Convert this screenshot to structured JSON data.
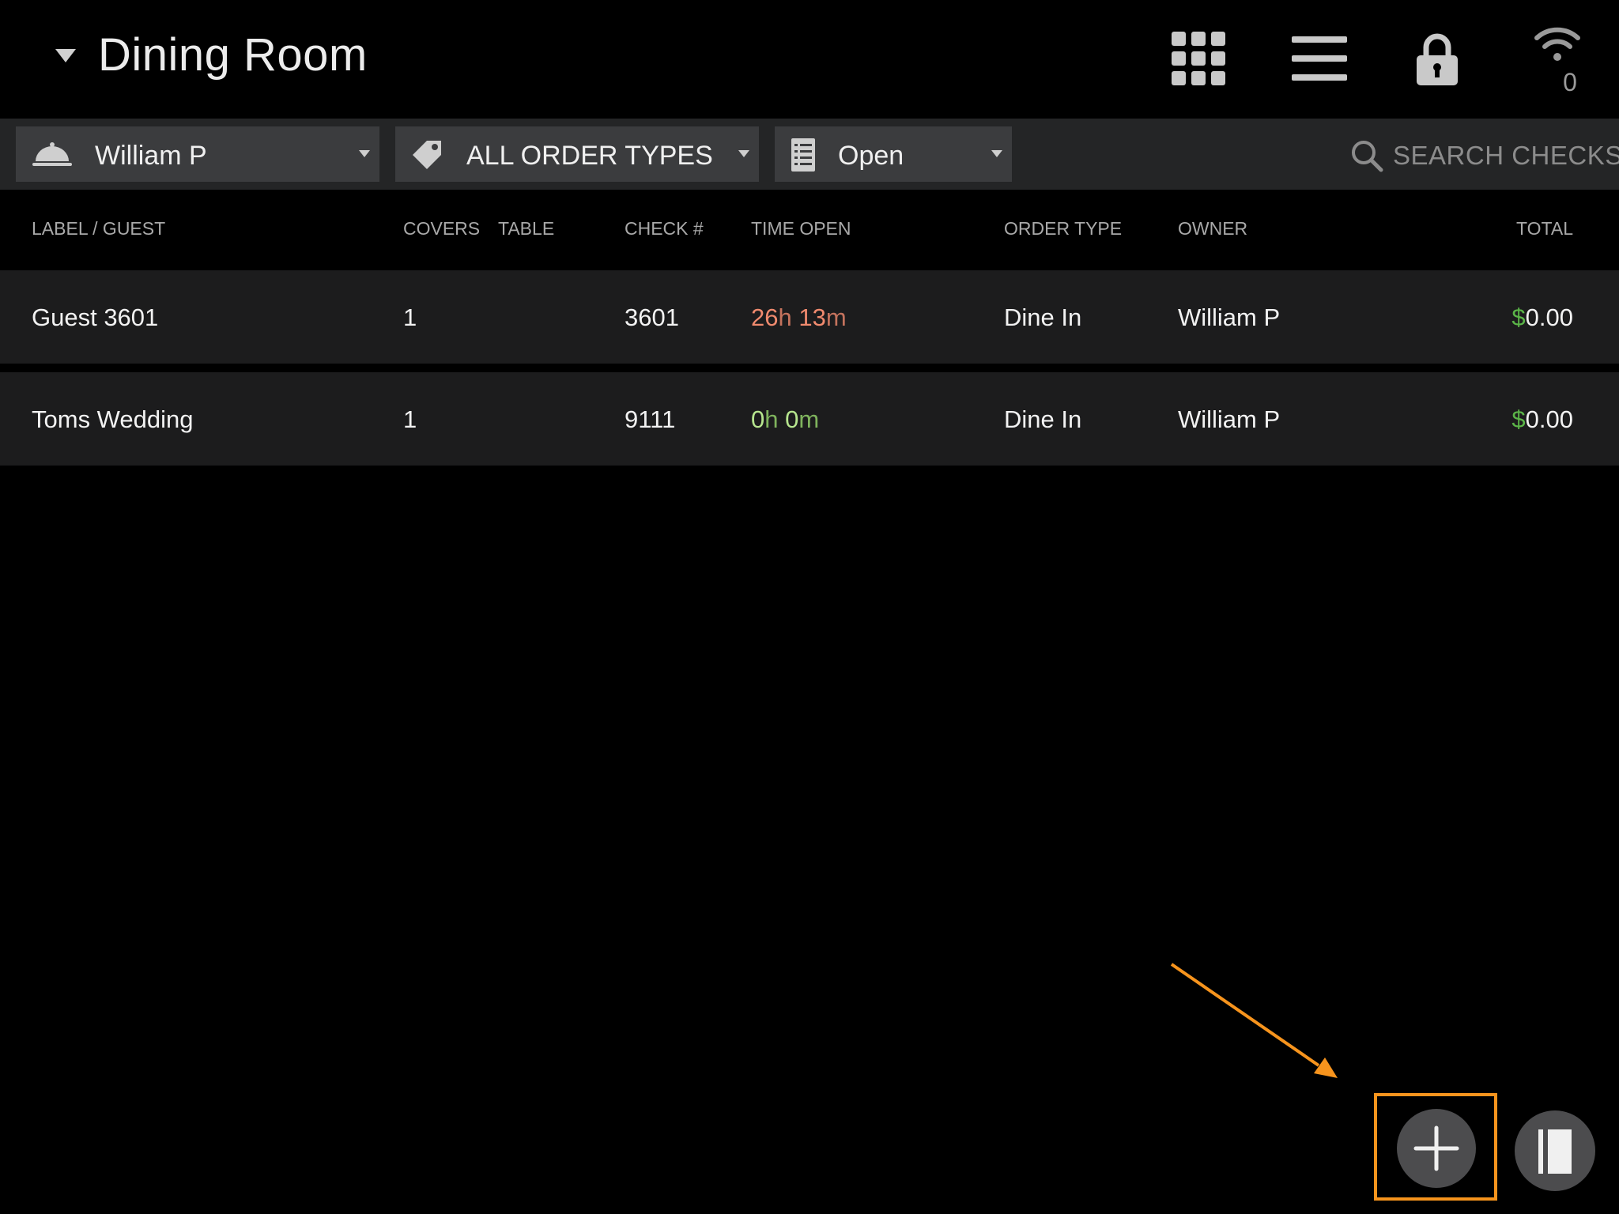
{
  "header": {
    "title": "Dining Room",
    "icons": [
      "caret-down-icon",
      "grid-icon",
      "menu-icon",
      "lock-icon",
      "wifi-icon"
    ],
    "wifi_count": "0"
  },
  "filters": {
    "server": {
      "label": "William P",
      "icon": "cloche-icon"
    },
    "order_types": {
      "label": "ALL ORDER TYPES",
      "icon": "tag-icon"
    },
    "status": {
      "label": "Open",
      "icon": "receipt-icon"
    },
    "search_placeholder": "SEARCH CHECKS"
  },
  "table": {
    "columns": {
      "label_guest": "LABEL / GUEST",
      "covers": "COVERS",
      "table": "TABLE",
      "check": "CHECK #",
      "time_open": "TIME OPEN",
      "order_type": "ORDER TYPE",
      "owner": "OWNER",
      "total": "TOTAL"
    },
    "rows": [
      {
        "label": "Guest 3601",
        "covers": "1",
        "table": "",
        "check": "3601",
        "time_h": "26",
        "time_h_unit": "h",
        "time_m": "13",
        "time_m_unit": "m",
        "order_type": "Dine In",
        "owner": "William P",
        "currency": "$",
        "amount": "0.00"
      },
      {
        "label": "Toms Wedding",
        "covers": "1",
        "table": "",
        "check": "9111",
        "time_h": "0",
        "time_h_unit": "h",
        "time_m": "0",
        "time_m_unit": "m",
        "order_type": "Dine In",
        "owner": "William P",
        "currency": "$",
        "amount": "0.00"
      }
    ]
  },
  "actions": {
    "new_check_icon": "plus-icon",
    "split_view_icon": "panel-icon"
  },
  "colors": {
    "background": "#000000",
    "filterbar": "#242526",
    "row": "#1c1c1d",
    "time_overdue": "#f08a6e",
    "time_fresh": "#b6e58e",
    "currency": "#5bb548",
    "highlight": "#f7941d"
  }
}
